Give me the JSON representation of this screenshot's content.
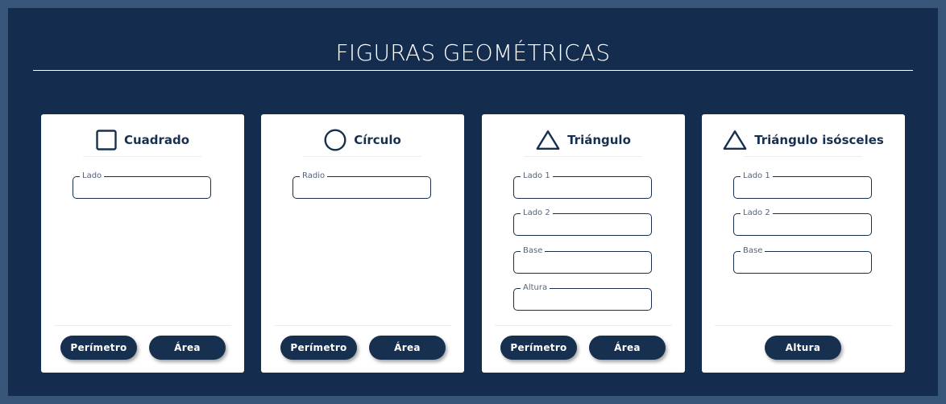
{
  "page": {
    "title": "FIGURAS GEOMÉTRICAS"
  },
  "colors": {
    "background": "#142d4f",
    "border": "#375479",
    "card": "#ffffff",
    "accent": "#17304f"
  },
  "cards": [
    {
      "title": "Cuadrado",
      "icon": "square-icon",
      "fields": [
        {
          "label": "Lado",
          "value": ""
        }
      ],
      "buttons": [
        {
          "label": "Perímetro"
        },
        {
          "label": "Área"
        }
      ]
    },
    {
      "title": "Círculo",
      "icon": "circle-icon",
      "fields": [
        {
          "label": "Radio",
          "value": ""
        }
      ],
      "buttons": [
        {
          "label": "Perímetro"
        },
        {
          "label": "Área"
        }
      ]
    },
    {
      "title": "Triángulo",
      "icon": "triangle-icon",
      "fields": [
        {
          "label": "Lado 1",
          "value": ""
        },
        {
          "label": "Lado 2",
          "value": ""
        },
        {
          "label": "Base",
          "value": ""
        },
        {
          "label": "Altura",
          "value": ""
        }
      ],
      "buttons": [
        {
          "label": "Perímetro"
        },
        {
          "label": "Área"
        }
      ]
    },
    {
      "title": "Triángulo isósceles",
      "icon": "triangle-icon",
      "fields": [
        {
          "label": "Lado 1",
          "value": ""
        },
        {
          "label": "Lado 2",
          "value": ""
        },
        {
          "label": "Base",
          "value": ""
        }
      ],
      "buttons": [
        {
          "label": "Altura"
        }
      ]
    }
  ]
}
